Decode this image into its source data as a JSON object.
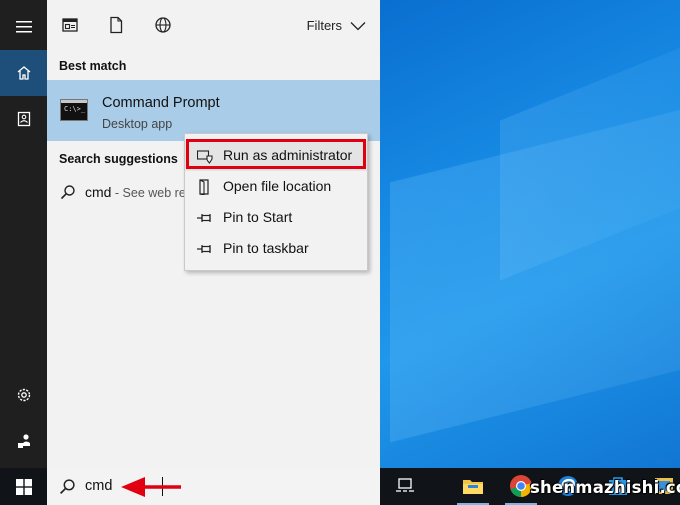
{
  "start_menu": {
    "filters_label": "Filters",
    "best_match_heading": "Best match",
    "best_match": {
      "title": "Command Prompt",
      "subtitle": "Desktop app",
      "icon_text": "C:\\>_"
    },
    "search_suggestions_heading": "Search suggestions",
    "suggestion": {
      "term": "cmd",
      "hint": " - See web re"
    }
  },
  "context_menu": {
    "items": [
      {
        "label": "Run as administrator",
        "icon": "shield-run-icon",
        "highlighted": true
      },
      {
        "label": "Open file location",
        "icon": "file-location-icon"
      },
      {
        "label": "Pin to Start",
        "icon": "pin-icon"
      },
      {
        "label": "Pin to taskbar",
        "icon": "pin-icon"
      }
    ]
  },
  "taskbar": {
    "search_value": "cmd",
    "pinned": [
      "task-view-icon",
      "file-explorer-icon",
      "chrome-icon",
      "edge-icon",
      "store-icon"
    ]
  },
  "watermark": "shenmazhishi.com",
  "colors": {
    "rail": "#1f1f1f",
    "rail_active": "#1e4f7a",
    "panel": "#f2f2f2",
    "best_match_highlight": "#a9cde9",
    "annotation_red": "#e00012",
    "taskbar": "#101418",
    "desktop": "#1689e3"
  }
}
